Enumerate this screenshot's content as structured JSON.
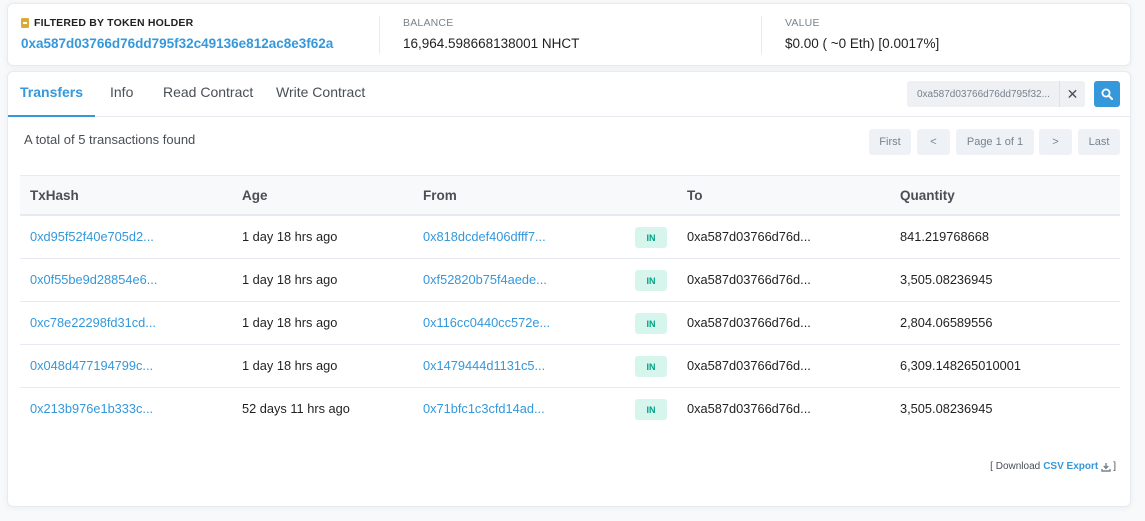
{
  "summary": {
    "holder_label": "FILTERED BY TOKEN HOLDER",
    "holder_address": "0xa587d03766d76dd795f32c49136e812ac8e3f62a",
    "balance_label": "BALANCE",
    "balance_value": "16,964.598668138001 NHCT",
    "value_label": "VALUE",
    "value_value": "$0.00 ( ~0 Eth) [0.0017%]"
  },
  "tabs": [
    "Transfers",
    "Info",
    "Read Contract",
    "Write Contract"
  ],
  "filter": {
    "text": "0xa587d03766d76dd795f32...",
    "clear": "✕"
  },
  "total_text": "A total of 5 transactions found",
  "pager": {
    "first": "First",
    "prev": "<",
    "page": "Page 1 of 1",
    "next": ">",
    "last": "Last"
  },
  "table": {
    "headers": [
      "TxHash",
      "Age",
      "From",
      "To",
      "Quantity"
    ],
    "rows": [
      {
        "hash": "0xd95f52f40e705d2...",
        "age": "1 day 18 hrs ago",
        "from": "0x818dcdef406dfff7...",
        "dir": "IN",
        "to": "0xa587d03766d76d...",
        "qty": "841.219768668"
      },
      {
        "hash": "0x0f55be9d28854e6...",
        "age": "1 day 18 hrs ago",
        "from": "0xf52820b75f4aede...",
        "dir": "IN",
        "to": "0xa587d03766d76d...",
        "qty": "3,505.08236945"
      },
      {
        "hash": "0xc78e22298fd31cd...",
        "age": "1 day 18 hrs ago",
        "from": "0x116cc0440cc572e...",
        "dir": "IN",
        "to": "0xa587d03766d76d...",
        "qty": "2,804.06589556"
      },
      {
        "hash": "0x048d477194799c...",
        "age": "1 day 18 hrs ago",
        "from": "0x1479444d1131c5...",
        "dir": "IN",
        "to": "0xa587d03766d76d...",
        "qty": "6,309.148265010001"
      },
      {
        "hash": "0x213b976e1b333c...",
        "age": "52 days 11 hrs ago",
        "from": "0x71bfc1c3cfd14ad...",
        "dir": "IN",
        "to": "0xa587d03766d76d...",
        "qty": "3,505.08236945"
      }
    ]
  },
  "download": {
    "prefix": "[ Download",
    "csv": "CSV Export",
    "suffix": "]"
  }
}
